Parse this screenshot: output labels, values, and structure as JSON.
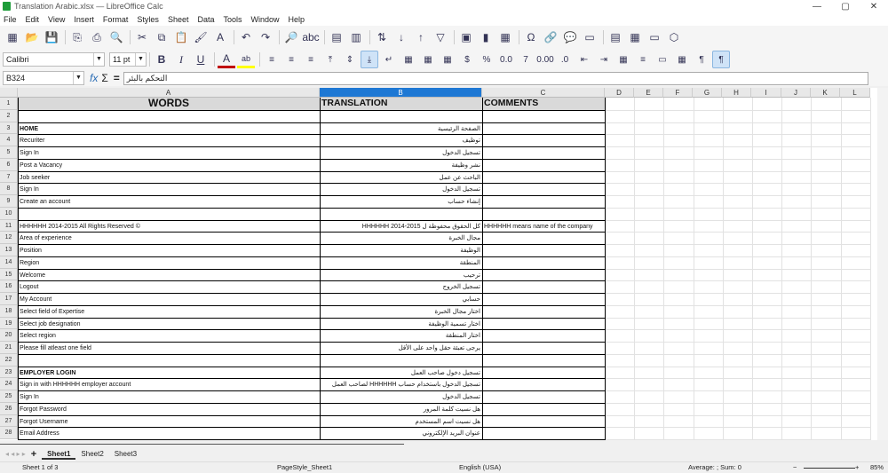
{
  "window": {
    "title": "Translation Arabic.xlsx — LibreOffice Calc",
    "min": "—",
    "max": "▢",
    "close": "✕"
  },
  "menu": [
    "File",
    "Edit",
    "View",
    "Insert",
    "Format",
    "Styles",
    "Sheet",
    "Data",
    "Tools",
    "Window",
    "Help"
  ],
  "toolbar_icons": [
    "new-icon",
    "open-icon",
    "save-icon",
    "export-pdf-icon",
    "print-icon",
    "print-preview-icon",
    "cut-icon",
    "copy-icon",
    "paste-icon",
    "clone-format-icon",
    "clear-format-icon",
    "undo-icon",
    "redo-icon",
    "find-replace-icon",
    "spelling-icon",
    "row-icon",
    "column-icon",
    "sort-icon",
    "sort-ascending-icon",
    "sort-descending-icon",
    "autofilter-icon",
    "image-icon",
    "chart-icon",
    "pivot-icon",
    "special-char-icon",
    "hyperlink-icon",
    "comment-icon",
    "header-footer-icon",
    "define-print-area-icon",
    "freeze-icon",
    "split-icon",
    "show-draw-icon"
  ],
  "toolbar_glyphs": [
    "▦",
    "📂",
    "💾",
    "⎘",
    "⎙",
    "🔍",
    "✂",
    "⧉",
    "📋",
    "🖌",
    "A",
    "↶",
    "↷",
    "🔎",
    "abc",
    "▤",
    "▥",
    "⇅",
    "↓",
    "↑",
    "▽",
    "▣",
    "▮",
    "▦",
    "Ω",
    "🔗",
    "💬",
    "▭",
    "▤",
    "▦",
    "▭",
    "⬡"
  ],
  "format": {
    "font_name": "Calibri",
    "font_size": "11 pt",
    "bold": "B",
    "italic": "I",
    "underline": "U",
    "font_color": "A",
    "highlight": "ab",
    "font_color_hex": "#c00000",
    "highlight_hex": "#ffff00"
  },
  "format_glyphs": [
    "≡",
    "≡",
    "≡",
    "⤒",
    "⇕",
    "⤓",
    "↵",
    "▦",
    "▦",
    "▦",
    "$",
    "%",
    "0.0",
    "7",
    "0.00",
    ".0",
    "⇤",
    "⇥",
    "▦",
    "≡",
    "▭",
    "▦",
    "¶",
    "¶"
  ],
  "formula": {
    "cell_ref": "B324",
    "fx": "fx",
    "sum": "Σ",
    "equals": "=",
    "content": "التحكم بالبئر"
  },
  "columns": [
    "A",
    "B",
    "C",
    "D",
    "E",
    "F",
    "G",
    "H",
    "I",
    "J",
    "K",
    "L"
  ],
  "selected_column": "B",
  "headers": {
    "a": "WORDS",
    "b": "TRANSLATION",
    "c": "COMMENTS"
  },
  "rows": [
    {
      "n": "1"
    },
    {
      "n": "2",
      "a": "",
      "b": ""
    },
    {
      "n": "3",
      "a": "HOME",
      "b": "الصفحة الرئيسية",
      "bold": true
    },
    {
      "n": "4",
      "a": "Recuriter",
      "b": "توظيف"
    },
    {
      "n": "5",
      "a": "Sign In",
      "b": "تسجيل الدخول"
    },
    {
      "n": "6",
      "a": "Post a Vacancy",
      "b": "نشر وظيفة"
    },
    {
      "n": "7",
      "a": "Job seeker",
      "b": "الباحث عن عمل"
    },
    {
      "n": "8",
      "a": "Sign In",
      "b": "تسجيل الدخول"
    },
    {
      "n": "9",
      "a": "Create an account",
      "b": "إنشاء حساب"
    },
    {
      "n": "10",
      "a": "",
      "b": ""
    },
    {
      "n": "11",
      "a": "HHHHHH 2014-2015 All Rights Reserved ©",
      "b": "كل الحقوق محفوظة ل 2015-2014 HHHHHH",
      "c": "HHHHHH  means name of the company"
    },
    {
      "n": "12",
      "a": "Area of experience",
      "b": "مجال الخبرة"
    },
    {
      "n": "13",
      "a": "Position",
      "b": "الوظيفة"
    },
    {
      "n": "14",
      "a": "Region",
      "b": "المنطقة"
    },
    {
      "n": "15",
      "a": "Welcome",
      "b": "ترحيب"
    },
    {
      "n": "16",
      "a": "Logout",
      "b": "تسجيل الخروج"
    },
    {
      "n": "17",
      "a": "My Account",
      "b": "حسابي"
    },
    {
      "n": "18",
      "a": "Select field of Expertise",
      "b": "اختار مجال الخبرة"
    },
    {
      "n": "19",
      "a": "Select job designation",
      "b": "اختار تسمية الوظيفة"
    },
    {
      "n": "20",
      "a": "Select region",
      "b": "اختار المنطقة"
    },
    {
      "n": "21",
      "a": "Please fill atleast one field",
      "b": "يرجى تعبئة حقل واحد على الأقل"
    },
    {
      "n": "22",
      "a": "",
      "b": ""
    },
    {
      "n": "23",
      "a": "EMPLOYER LOGIN",
      "b": "تسجيل دخول صاحب العمل",
      "bold": true
    },
    {
      "n": "24",
      "a": "Sign  in  with  HHHHHH  employer  account",
      "b": "تسجيل الدخول باستخدام حساب HHHHHH لصاحب العمل"
    },
    {
      "n": "25",
      "a": "Sign In",
      "b": "تسجيل الدخول"
    },
    {
      "n": "26",
      "a": "Forgot Password",
      "b": "هل نسيت كلمة المرور"
    },
    {
      "n": "27",
      "a": "Forgot Username",
      "b": "هل نسيت اسم المستخدم"
    },
    {
      "n": "28",
      "a": "Email Address",
      "b": "عنوان البريد الإلكتروني"
    }
  ],
  "sheets": {
    "add": "+",
    "tabs": [
      "Sheet1",
      "Sheet2",
      "Sheet3"
    ],
    "active": "Sheet1"
  },
  "status": {
    "sheet": "Sheet 1 of 3",
    "page_style": "PageStyle_Sheet1",
    "language": "English (USA)",
    "summary": "Average: ; Sum: 0",
    "zoom": "85%",
    "zoom_minus": "−",
    "zoom_plus": "+"
  }
}
